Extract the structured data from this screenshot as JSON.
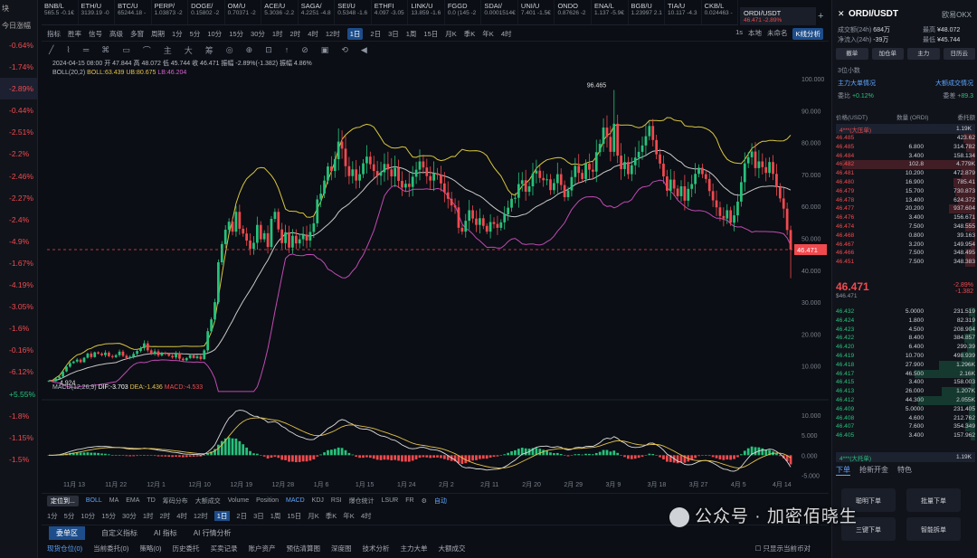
{
  "left_panel": {
    "header": "块",
    "sub": "今日涨幅",
    "pcts": [
      {
        "v": "-0.64%",
        "c": "red"
      },
      {
        "v": "-1.74%",
        "c": "red"
      },
      {
        "v": "-2.89%",
        "c": "red",
        "sel": true
      },
      {
        "v": "-0.44%",
        "c": "red"
      },
      {
        "v": "-2.51%",
        "c": "red"
      },
      {
        "v": "-2.2%",
        "c": "red"
      },
      {
        "v": "-2.46%",
        "c": "red"
      },
      {
        "v": "-2.27%",
        "c": "red"
      },
      {
        "v": "-2.4%",
        "c": "red"
      },
      {
        "v": "-4.9%",
        "c": "red"
      },
      {
        "v": "-1.67%",
        "c": "red"
      },
      {
        "v": "-4.19%",
        "c": "red"
      },
      {
        "v": "-3.05%",
        "c": "red"
      },
      {
        "v": "-1.6%",
        "c": "red"
      },
      {
        "v": "-0.16%",
        "c": "red"
      },
      {
        "v": "-6.12%",
        "c": "red"
      },
      {
        "v": "+5.55%",
        "c": "green"
      },
      {
        "v": "-1.8%",
        "c": "red"
      },
      {
        "v": "-1.15%",
        "c": "red"
      },
      {
        "v": "-1.5%",
        "c": "red"
      }
    ]
  },
  "ticker": [
    {
      "n": "BNB/L",
      "v": "565.5 -0.1€"
    },
    {
      "n": "ETH/U",
      "v": "3139.19 -0"
    },
    {
      "n": "BTC/U",
      "v": "65244.18 -"
    },
    {
      "n": "PERP/",
      "v": "1.03873 -2"
    },
    {
      "n": "DOGE/",
      "v": "0.15802 -2"
    },
    {
      "n": "OM/U",
      "v": "0.70371 -2"
    },
    {
      "n": "ACE/U",
      "v": "5.3036 -2.2"
    },
    {
      "n": "SAGA/",
      "v": "4.2251 -4.8"
    },
    {
      "n": "SEI/U",
      "v": "0.5348 -1.6"
    },
    {
      "n": "ETHFI",
      "v": "4.097 -3.05"
    },
    {
      "n": "LINK/U",
      "v": "13.859 -1.6"
    },
    {
      "n": "FGGD",
      "v": "0.0 (145 -2"
    },
    {
      "n": "SDAI/",
      "v": "0.0001514€"
    },
    {
      "n": "UNI/U",
      "v": "7.401 -1.5€"
    },
    {
      "n": "ONDO",
      "v": "0.87626 -2"
    },
    {
      "n": "ENA/L",
      "v": "1.137 -5.9€"
    },
    {
      "n": "BGB/U",
      "v": "1.23997 2.1"
    },
    {
      "n": "TIA/U",
      "v": "10.117 -4.3"
    },
    {
      "n": "CKB/L",
      "v": "0.024463 -"
    }
  ],
  "current_tab": {
    "sym": "ORDI/USDT",
    "val": "46.471 -2.89%"
  },
  "toolbar1": [
    "指标",
    "胜率",
    "信号",
    "高级",
    "多窗",
    "周期",
    "1分",
    "5分",
    "10分",
    "15分",
    "30分",
    "1时",
    "2时",
    "4时",
    "12时",
    "1日",
    "2日",
    "3日",
    "1周",
    "15日",
    "月K",
    "季K",
    "年K",
    "4时"
  ],
  "toolbar1_active": "1日",
  "toolbar1_right": [
    "1s",
    "本地",
    "未命名",
    "K线分析"
  ],
  "toolbar2": [
    "╱",
    "⌇",
    "═",
    "⌘",
    "▭",
    "⌒",
    "主",
    "大",
    "筹",
    "◎",
    "⊕",
    "⊡",
    "↑",
    "⊘",
    "▣",
    "⟲",
    "◀"
  ],
  "info": {
    "line1": "2024-04-15 08:00 开 47.844 高 48.072 低 45.744 收 46.471 振幅 -2.89%(-1.382) 振幅 4.86%",
    "boll_label": "BOLL(20,2)",
    "boll_mid": "BOLL:63.439",
    "boll_up": "UB:80.675",
    "boll_lo": "LB:46.204",
    "macd_label": "MACD(12,26,9)",
    "macd_dif": "DIF:-3.703",
    "macd_dea": "DEA:-1.436",
    "macd_val": "MACD:-4.533"
  },
  "chart_data": {
    "type": "candlestick",
    "price_axis": [
      "100.000",
      "90.000",
      "80.000",
      "70.000",
      "60.000",
      "50.000",
      "40.000",
      "30.000",
      "20.000",
      "10.000"
    ],
    "macd_axis": [
      "10.000",
      "5.000",
      "0.000",
      "-5.000"
    ],
    "x_labels": [
      "11月 13",
      "11月 22",
      "12月 1",
      "12月 10",
      "12月 19",
      "12月 28",
      "1月 6",
      "1月 15",
      "1月 24",
      "2月 2",
      "2月 11",
      "2月 20",
      "2月 29",
      "3月 9",
      "3月 18",
      "3月 27",
      "4月 5",
      "4月 14"
    ],
    "annotations": {
      "high": "96.465",
      "low": "4.924",
      "last": "46.471"
    },
    "closes": [
      5.4,
      5.2,
      6.1,
      6.7,
      8.3,
      9.8,
      10.9,
      11.4,
      12.0,
      11.2,
      12.6,
      13.9,
      12.8,
      14.3,
      13.9,
      13.4,
      14.2,
      13.1,
      12.8,
      13.4,
      14.5,
      13.2,
      12.5,
      12.9,
      13.8,
      14.7,
      15.6,
      17.1,
      14.9,
      13.9,
      14.6,
      13.3,
      14.1,
      13.8,
      13.2,
      12.7,
      13.9,
      12.3,
      11.8,
      12.5,
      13.4,
      12.5,
      13.0,
      12.2,
      14.9,
      20.9,
      24.6,
      30.0,
      42.5,
      48.2,
      52.7,
      55.2,
      52.1,
      58.3,
      53.0,
      51.5,
      49.3,
      46.7,
      48.6,
      54.2,
      49.7,
      51.6,
      47.3,
      56.1,
      58.3,
      52.8,
      48.5,
      51.9,
      47.1,
      50.8,
      48.4,
      49.7,
      51.2,
      49.3,
      52.0,
      54.7,
      62.2,
      64.0,
      68.1,
      72.5,
      71.1,
      74.8,
      80.3,
      78.1,
      72.6,
      69.5,
      71.6,
      68.1,
      70.1,
      73.5,
      75.6,
      73.2,
      71.1,
      69.6,
      70.7,
      73.3,
      71.6,
      69.4,
      72.1,
      68.0,
      65.9,
      67.1,
      66.1,
      69.3,
      71.5,
      74.1,
      72.2,
      69.5,
      68.1,
      70.4,
      69.9,
      67.2,
      64.4,
      62.4,
      60.3,
      59.7,
      53.3,
      52.1,
      55.5,
      58.8,
      56.2,
      54.2,
      56.3,
      53.9,
      52.1,
      55.1,
      54.5,
      53.3,
      55.0,
      57.5,
      59.6,
      62.4,
      62.7,
      67.0,
      68.2,
      64.6,
      66.3,
      70.3,
      71.2,
      68.9,
      68.2,
      68.5,
      65.1,
      67.3,
      70.1,
      66.7,
      62.9,
      65.0,
      69.2,
      72.7,
      70.5,
      68.6,
      73.4,
      71.5,
      70.9,
      77.0,
      79.6,
      84.7,
      81.8,
      77.1,
      85.9,
      75.9,
      71.7,
      73.9,
      70.1,
      72.9,
      75.3,
      77.1,
      79.1,
      82.0,
      85.2,
      80.8,
      76.3,
      73.4,
      69.4,
      64.9,
      68.4,
      65.6,
      63.2,
      66.3,
      61.8,
      65.5,
      67.0,
      70.2,
      72.1,
      70.1,
      68.6,
      64.8,
      61.9,
      59.7,
      57.0,
      56.2,
      58.8,
      54.9,
      57.2,
      61.5,
      67.6,
      73.5,
      75.4,
      77.2,
      72.0,
      74.1,
      72.3,
      70.5,
      73.9,
      70.2,
      66.0,
      62.5,
      59.3,
      52.6,
      46.471
    ],
    "high": 96.465,
    "low": 4.924
  },
  "bottom_tabs1": [
    "定位到...",
    "BOLL",
    "MA",
    "EMA",
    "TD",
    "筹码分布",
    "大额成交",
    "Volume",
    "Position",
    "MACD",
    "KDJ",
    "RSI",
    "爆仓统计",
    "LSUR",
    "FR",
    "⚙",
    "自动"
  ],
  "bottom_tabs2": [
    "1分",
    "5分",
    "10分",
    "15分",
    "30分",
    "1时",
    "2时",
    "4时",
    "12时",
    "1日",
    "2日",
    "3日",
    "1周",
    "15日",
    "月K",
    "季K",
    "年K",
    "4时"
  ],
  "bottom_tabs3": [
    "委单区",
    "自定义指标",
    "AI 指标",
    "AI 行情分析"
  ],
  "bottom_tabs4": [
    "现货仓位(0)",
    "当前委托(0)",
    "策略(0)",
    "历史委托",
    "买卖记录",
    "账户资产",
    "预估清算图",
    "深度图",
    "技术分析",
    "主力大单",
    "大额成交"
  ],
  "bottom_check": "只显示当前币对",
  "right": {
    "sym": "ORDI/USDT",
    "exchange": "欧易OKX",
    "vol_label": "成交额(24h)",
    "vol": "684万",
    "high_label": "最高",
    "high": "¥48.072",
    "net_label": "净流入(24h)",
    "net": "-39万",
    "low_label": "最低",
    "low": "¥45.744",
    "buttons": [
      "撤单",
      "加仓单",
      "主力",
      "日历云"
    ],
    "misc": {
      "depth": "3位小数",
      "main_in": "主力大单情况",
      "big_deal": "大额成交情况",
      "ratio_label": "委比",
      "ratio": "+0.12%",
      "diff_label": "委差",
      "diff": "+89.3"
    },
    "ob_head": [
      "价格(USDT)",
      "数量 (ORDI)",
      "委托额"
    ],
    "ask_bar": {
      "l": "4***(大压单)",
      "r": "1.19K"
    },
    "asks": [
      [
        "46.485",
        "",
        "423.62"
      ],
      [
        "46.485",
        "6.800",
        "314.782"
      ],
      [
        "46.484",
        "3.400",
        "158.134"
      ],
      [
        "46.482",
        "102.8",
        "4.779K"
      ],
      [
        "46.481",
        "10.200",
        "472.879"
      ],
      [
        "46.480",
        "16.900",
        "785.41"
      ],
      [
        "46.479",
        "15.700",
        "730.873"
      ],
      [
        "46.478",
        "13.400",
        "624.372"
      ],
      [
        "46.477",
        "20.200",
        "937.604"
      ],
      [
        "46.476",
        "3.400",
        "156.671"
      ],
      [
        "46.474",
        "7.500",
        "348.555"
      ],
      [
        "46.468",
        "0.800",
        "39.163"
      ],
      [
        "46.467",
        "3.200",
        "149.954"
      ],
      [
        "46.466",
        "7.500",
        "348.495"
      ],
      [
        "46.451",
        "7.500",
        "348.383"
      ]
    ],
    "last": "46.471",
    "last_sub": "$46.471",
    "chg": "-2.89%",
    "chg_abs": "-1.382",
    "bids": [
      [
        "46.432",
        "5.0000",
        "231.519"
      ],
      [
        "46.424",
        "1.800",
        "82.319"
      ],
      [
        "46.423",
        "4.500",
        "208.904"
      ],
      [
        "46.422",
        "8.400",
        "384.857"
      ],
      [
        "46.420",
        "6.400",
        "299.39"
      ],
      [
        "46.419",
        "10.700",
        "498.939"
      ],
      [
        "46.418",
        "27.900",
        "1.296K"
      ],
      [
        "46.417",
        "46.500",
        "2.16K"
      ],
      [
        "46.415",
        "3.400",
        "158.003"
      ],
      [
        "46.413",
        "26.000",
        "1.207K"
      ],
      [
        "46.412",
        "44.300",
        "2.055K"
      ],
      [
        "46.409",
        "5.0000",
        "231.405"
      ],
      [
        "46.408",
        "4.600",
        "212.762"
      ],
      [
        "46.407",
        "7.600",
        "354.349"
      ],
      [
        "46.405",
        "3.400",
        "157.962"
      ]
    ],
    "bid_bar": {
      "l": "4***(大托单)",
      "r": "1.19K"
    },
    "tabs": [
      "下单",
      "抢新开金",
      "特色"
    ],
    "grid": [
      "聪明下单",
      "批量下单",
      "三键下单",
      "智能拆单"
    ]
  },
  "watermark": "公众号 · 加密佰晓生"
}
